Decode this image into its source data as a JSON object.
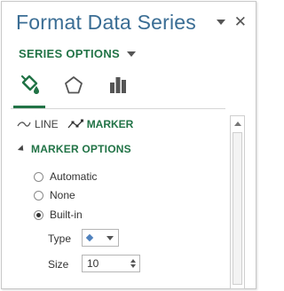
{
  "pane": {
    "title": "Format Data Series",
    "series_options_label": "SERIES OPTIONS"
  },
  "icon_tabs": [
    {
      "icon": "fill-line-icon",
      "selected": true
    },
    {
      "icon": "effects-pentagon-icon",
      "selected": false
    },
    {
      "icon": "bar-chart-series-options-icon",
      "selected": false
    }
  ],
  "subtabs": {
    "line_label": "LINE",
    "marker_label": "MARKER",
    "active": "MARKER"
  },
  "marker_options": {
    "section_label": "MARKER OPTIONS",
    "radios": [
      {
        "label": "Automatic",
        "checked": false
      },
      {
        "label": "None",
        "checked": false
      },
      {
        "label": "Built-in",
        "checked": true
      }
    ],
    "type_label": "Type",
    "size_label": "Size",
    "size_value": "10"
  },
  "colors": {
    "title": "#3a6d94",
    "accent_green": "#217346",
    "marker_blue": "#4f81bd"
  }
}
